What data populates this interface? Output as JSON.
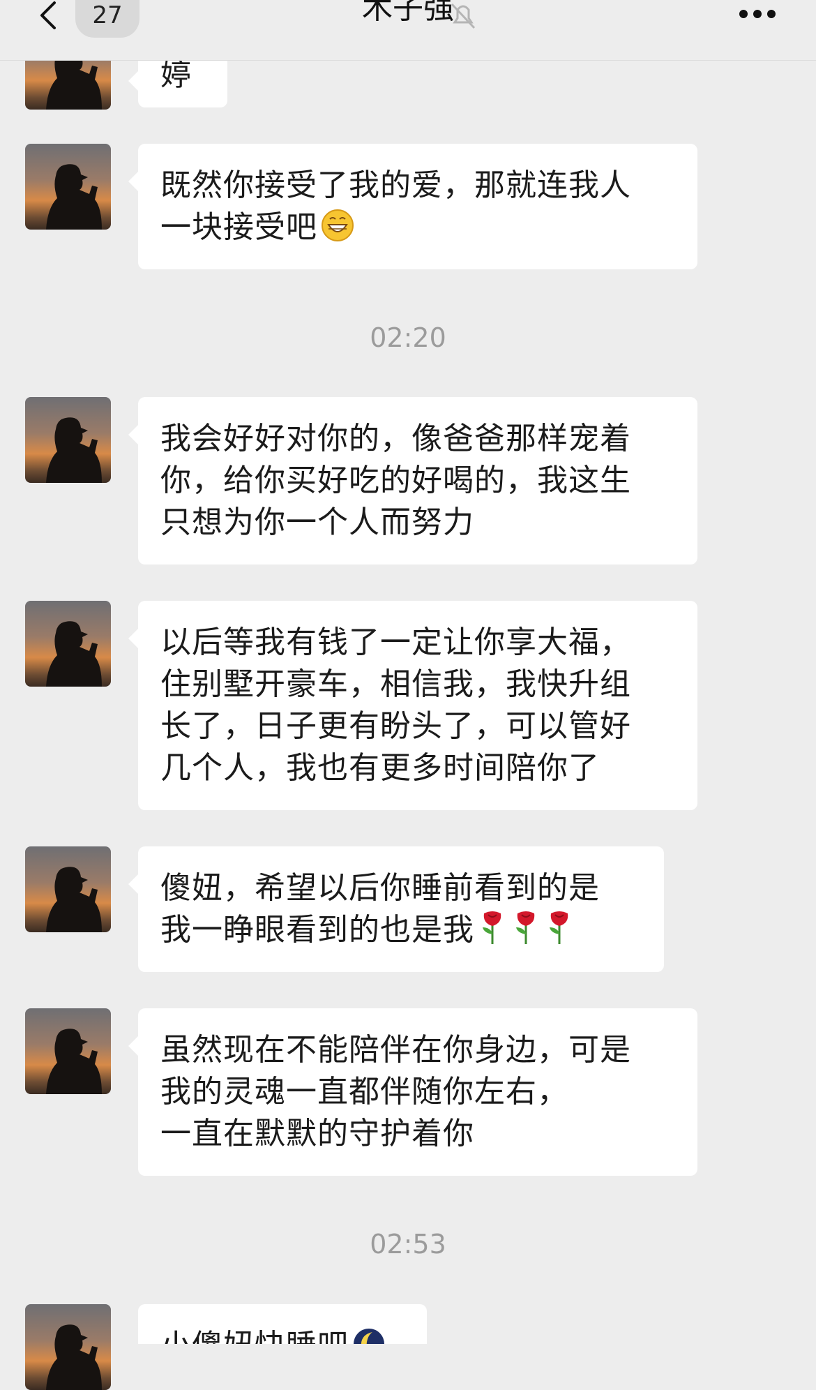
{
  "header": {
    "back_label": "back",
    "unread_count": "27",
    "title": "木子强",
    "mute_icon": "bell-muted-icon",
    "more_icon": "more-dots-icon"
  },
  "messages": [
    {
      "lines": [
        "婷"
      ]
    },
    {
      "lines": [
        "既然你接受了我的爱，那就连我人",
        "一块接受吧"
      ],
      "emoji": "grinning-face"
    },
    {
      "lines": [
        "我会好好对你的，像爸爸那样宠着",
        "你，给你买好吃的好喝的，我这生",
        "只想为你一个人而努力"
      ]
    },
    {
      "lines": [
        "以后等我有钱了一定让你享大福，",
        "住别墅开豪车，相信我，我快升组",
        "长了，日子更有盼头了，可以管好",
        "几个人，我也有更多时间陪你了"
      ]
    },
    {
      "lines": [
        "傻妞，希望以后你睡前看到的是",
        "我一睁眼看到的也是我"
      ],
      "emoji": "rose x3"
    },
    {
      "lines": [
        "虽然现在不能陪伴在你身边，可是",
        "我的灵魂一直都伴随你左右，",
        "一直在默默的守护着你"
      ]
    },
    {
      "lines": [
        "小傻妞快睡吧"
      ],
      "emoji": "crescent-moon"
    }
  ],
  "timestamps": [
    "02:20",
    "02:53"
  ],
  "colors": {
    "background": "#ededed",
    "bubble": "#ffffff",
    "timestamp": "#9b9b9b"
  }
}
